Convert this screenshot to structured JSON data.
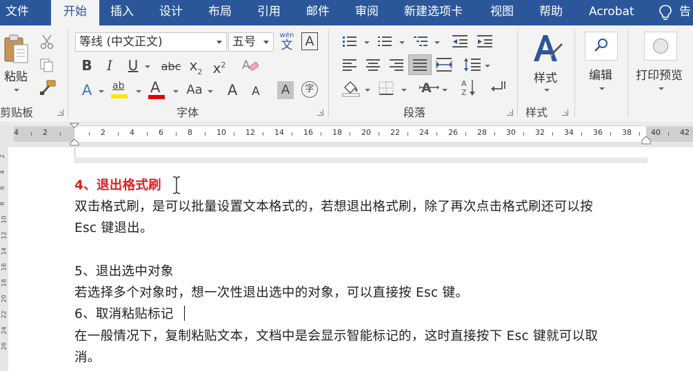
{
  "tabs": [
    {
      "label": "文件",
      "active": false
    },
    {
      "label": "开始",
      "active": true
    },
    {
      "label": "插入",
      "active": false
    },
    {
      "label": "设计",
      "active": false
    },
    {
      "label": "布局",
      "active": false
    },
    {
      "label": "引用",
      "active": false
    },
    {
      "label": "邮件",
      "active": false
    },
    {
      "label": "审阅",
      "active": false
    },
    {
      "label": "新建选项卡",
      "active": false
    },
    {
      "label": "视图",
      "active": false
    },
    {
      "label": "帮助",
      "active": false
    },
    {
      "label": "Acrobat",
      "active": false
    },
    {
      "label": "告",
      "active": false
    }
  ],
  "ribbon": {
    "clipboard": {
      "paste_label": "粘贴",
      "group_label": "剪贴板"
    },
    "font": {
      "font_name": "等线 (中文正文)",
      "font_size": "五号",
      "wen_top": "wén",
      "wen_bottom": "文",
      "border_char": "A",
      "bold": "B",
      "italic": "I",
      "underline": "U",
      "strike": "abc",
      "sub_base": "x",
      "sub_mark": "2",
      "sup_base": "x",
      "sup_mark": "2",
      "text_effect": "A",
      "highlight": "ab",
      "font_color": "A",
      "change_case": "Aa",
      "grow_font": "A",
      "shrink_font": "A",
      "char_shading": "A",
      "enclose_char": "字",
      "group_label": "字体"
    },
    "paragraph": {
      "group_label": "段落"
    },
    "styles": {
      "label": "样式",
      "group_label": "样式"
    },
    "editing": {
      "label": "编辑"
    },
    "print": {
      "label": "打印预览"
    }
  },
  "ruler": {
    "labels": [
      "4",
      "2",
      "2",
      "4",
      "6",
      "8",
      "10",
      "12",
      "14",
      "16",
      "18",
      "20",
      "22",
      "24",
      "26",
      "28",
      "30",
      "32",
      "34",
      "36",
      "38",
      "40",
      "42"
    ]
  },
  "vruler": {
    "labels": [
      "2",
      "4",
      "6",
      "8",
      "10",
      "12",
      "14",
      "16",
      "18",
      "20",
      "22",
      "24",
      "26"
    ]
  },
  "document": {
    "heading4": "4、退出格式刷",
    "p1_line1": "双击格式刷，是可以批量设置文本格式的，若想退出格式刷，除了再次点击格式刷还可以按",
    "p1_line2": "Esc 键退出。",
    "heading5": "5、退出选中对象",
    "p2": "若选择多个对象时，想一次性退出选中的对象，可以直接按 Esc 键。",
    "heading6": "6、取消粘贴标记",
    "p3_line1": "在一般情况下，复制粘贴文本，文档中是会显示智能标记的，这时直接按下 Esc 键就可以取",
    "p3_line2": "消。"
  },
  "colors": {
    "tab_bar": "#2b579a",
    "ribbon_bg": "#f3f3f3",
    "heading_red": "#e02020",
    "highlight_yellow": "#ffe500",
    "font_color_red": "#e00000"
  }
}
